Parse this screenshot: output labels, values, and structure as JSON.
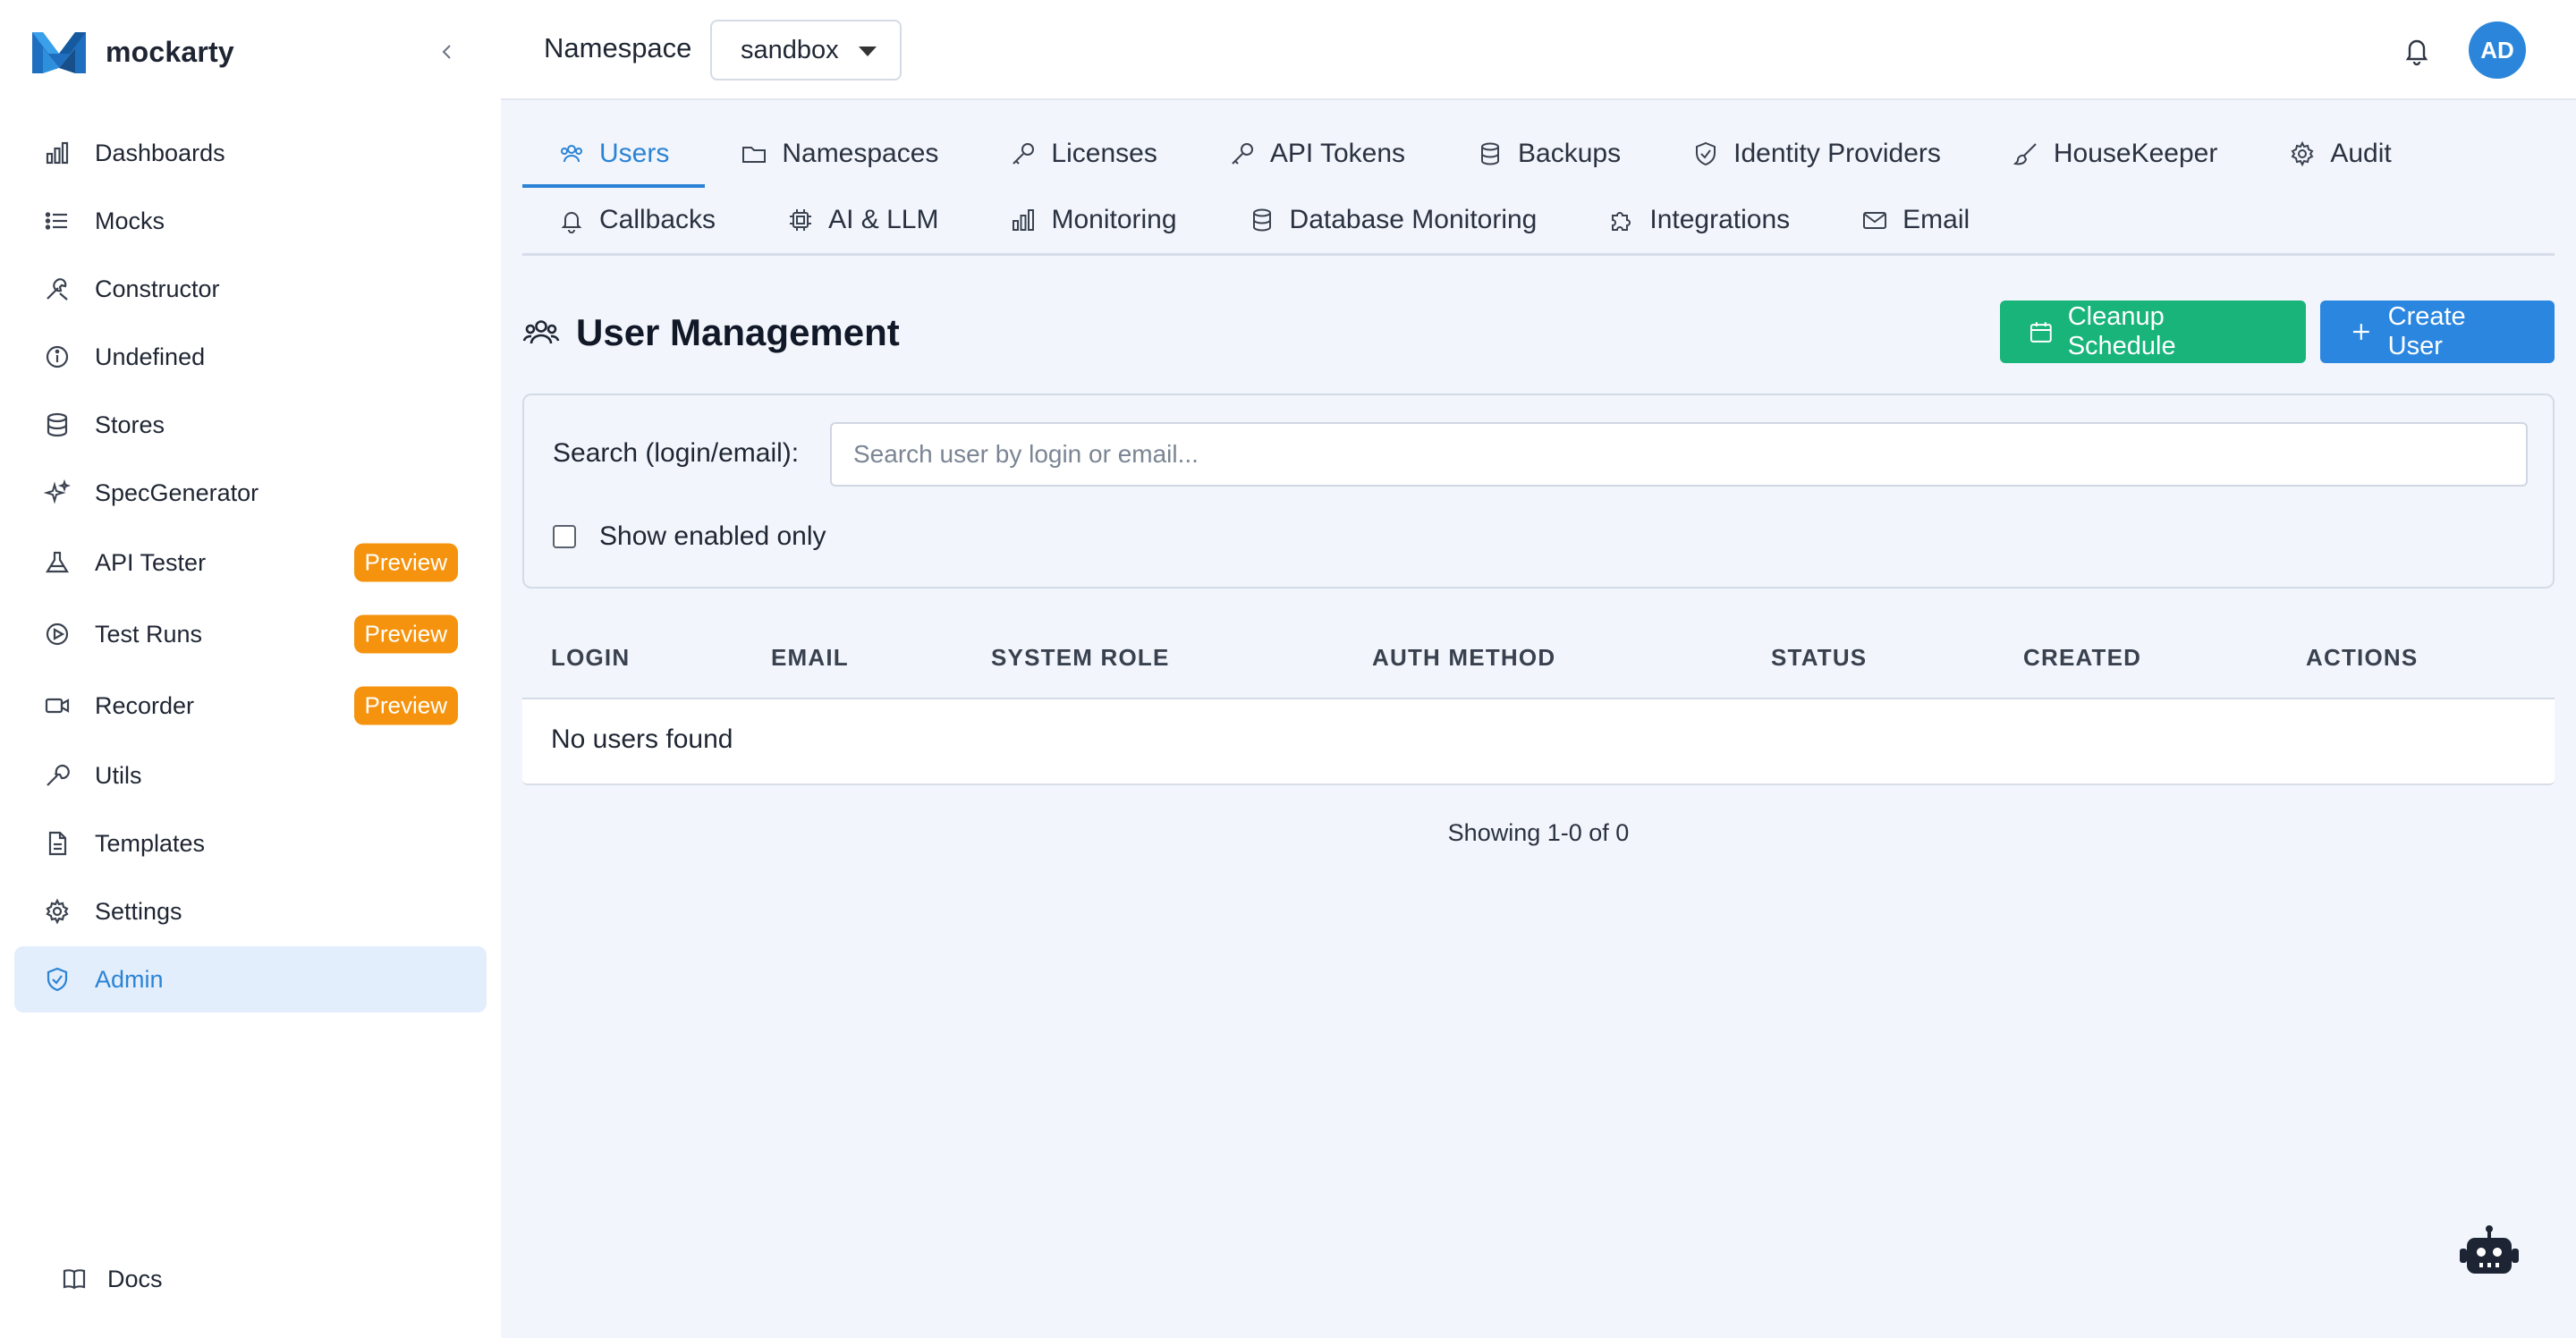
{
  "app": {
    "name": "mockarty"
  },
  "sidebar": {
    "items": [
      {
        "label": "Dashboards",
        "icon": "bar-chart-icon"
      },
      {
        "label": "Mocks",
        "icon": "list-icon"
      },
      {
        "label": "Constructor",
        "icon": "tools-icon"
      },
      {
        "label": "Undefined",
        "icon": "info-icon"
      },
      {
        "label": "Stores",
        "icon": "database-icon"
      },
      {
        "label": "SpecGenerator",
        "icon": "sparkles-icon"
      },
      {
        "label": "API Tester",
        "icon": "flask-icon",
        "badge": "Preview"
      },
      {
        "label": "Test Runs",
        "icon": "play-circle-icon",
        "badge": "Preview"
      },
      {
        "label": "Recorder",
        "icon": "video-icon",
        "badge": "Preview"
      },
      {
        "label": "Utils",
        "icon": "wrench-icon"
      },
      {
        "label": "Templates",
        "icon": "file-text-icon"
      },
      {
        "label": "Settings",
        "icon": "gear-icon"
      },
      {
        "label": "Admin",
        "icon": "shield-icon",
        "active": true
      }
    ],
    "docs_label": "Docs"
  },
  "topbar": {
    "namespace_label": "Namespace",
    "namespace_value": "sandbox",
    "avatar_initials": "AD"
  },
  "tabs": {
    "row1": [
      {
        "label": "Users",
        "icon": "users-icon",
        "active": true
      },
      {
        "label": "Namespaces",
        "icon": "folder-icon"
      },
      {
        "label": "Licenses",
        "icon": "key-icon"
      },
      {
        "label": "API Tokens",
        "icon": "key-icon"
      },
      {
        "label": "Backups",
        "icon": "database-icon"
      },
      {
        "label": "Identity Providers",
        "icon": "shield-icon"
      },
      {
        "label": "HouseKeeper",
        "icon": "brush-icon"
      },
      {
        "label": "Audit",
        "icon": "gear-icon"
      }
    ],
    "row2": [
      {
        "label": "Callbacks",
        "icon": "bell-icon"
      },
      {
        "label": "AI & LLM",
        "icon": "cpu-icon"
      },
      {
        "label": "Monitoring",
        "icon": "bar-chart-icon"
      },
      {
        "label": "Database Monitoring",
        "icon": "database-icon"
      },
      {
        "label": "Integrations",
        "icon": "puzzle-icon"
      },
      {
        "label": "Email",
        "icon": "mail-icon"
      }
    ]
  },
  "main": {
    "title": "User Management",
    "cleanup_button": "Cleanup Schedule",
    "create_button": "Create User",
    "filter": {
      "search_label": "Search (login/email):",
      "search_placeholder": "Search user by login or email...",
      "search_value": "",
      "show_enabled_label": "Show enabled only",
      "show_enabled_checked": false
    },
    "table": {
      "columns": [
        "LOGIN",
        "EMAIL",
        "SYSTEM ROLE",
        "AUTH METHOD",
        "STATUS",
        "CREATED",
        "ACTIONS"
      ],
      "rows": [],
      "empty_message": "No users found"
    },
    "pagination_text": "Showing 1-0 of 0"
  },
  "colors": {
    "accent": "#2b83d6",
    "green_button": "#18b47a",
    "blue_button": "#2b86e0",
    "badge": "#f5930e",
    "active_nav_bg": "#e3eefc",
    "page_bg": "#f2f5fb"
  }
}
